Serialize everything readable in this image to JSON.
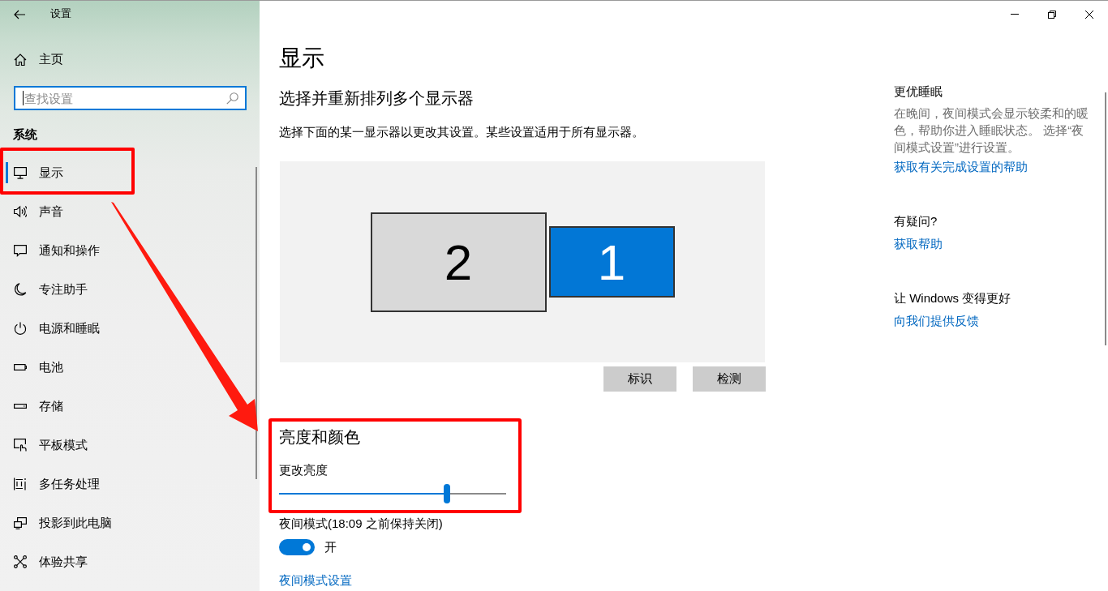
{
  "window": {
    "title": "设置"
  },
  "sidebar": {
    "home": {
      "label": "主页"
    },
    "search": {
      "placeholder": "查找设置",
      "focused": true
    },
    "section_title": "系统",
    "items": [
      {
        "label": "显示",
        "selected": true,
        "highlighted": true
      },
      {
        "label": "声音",
        "selected": false,
        "highlighted": false
      },
      {
        "label": "通知和操作",
        "selected": false,
        "highlighted": false
      },
      {
        "label": "专注助手",
        "selected": false,
        "highlighted": false
      },
      {
        "label": "电源和睡眠",
        "selected": false,
        "highlighted": false
      },
      {
        "label": "电池",
        "selected": false,
        "highlighted": false
      },
      {
        "label": "存储",
        "selected": false,
        "highlighted": false
      },
      {
        "label": "平板模式",
        "selected": false,
        "highlighted": false
      },
      {
        "label": "多任务处理",
        "selected": false,
        "highlighted": false
      },
      {
        "label": "投影到此电脑",
        "selected": false,
        "highlighted": false
      },
      {
        "label": "体验共享",
        "selected": false,
        "highlighted": false
      }
    ]
  },
  "page": {
    "title": "显示"
  },
  "display": {
    "heading": "选择并重新排列多个显示器",
    "description": "选择下面的某一显示器以更改其设置。某些设置适用于所有显示器。",
    "monitors": [
      {
        "label": "2",
        "selected": false
      },
      {
        "label": "1",
        "selected": true
      }
    ],
    "buttons": [
      "标识",
      "检测"
    ]
  },
  "brightness": {
    "heading": "亮度和颜色",
    "highlighted": true,
    "slider_label": "更改亮度",
    "level": 0.74
  },
  "night_light": {
    "label": "夜间模式(18:09 之前保持关闭)",
    "on": true,
    "state_label": "开",
    "link": "夜间模式设置"
  },
  "related": [
    {
      "heading": "更优睡眠",
      "text": "在晚间，夜间模式会显示较柔和的暖色，帮助你进入睡眠状态。 选择“夜间模式设置”进行设置。",
      "link": "获取有关完成设置的帮助"
    },
    {
      "heading": "有疑问?",
      "link": "获取帮助"
    },
    {
      "heading": "让 Windows 变得更好",
      "link": "向我们提供反馈"
    }
  ],
  "annotation_arrow": true
}
